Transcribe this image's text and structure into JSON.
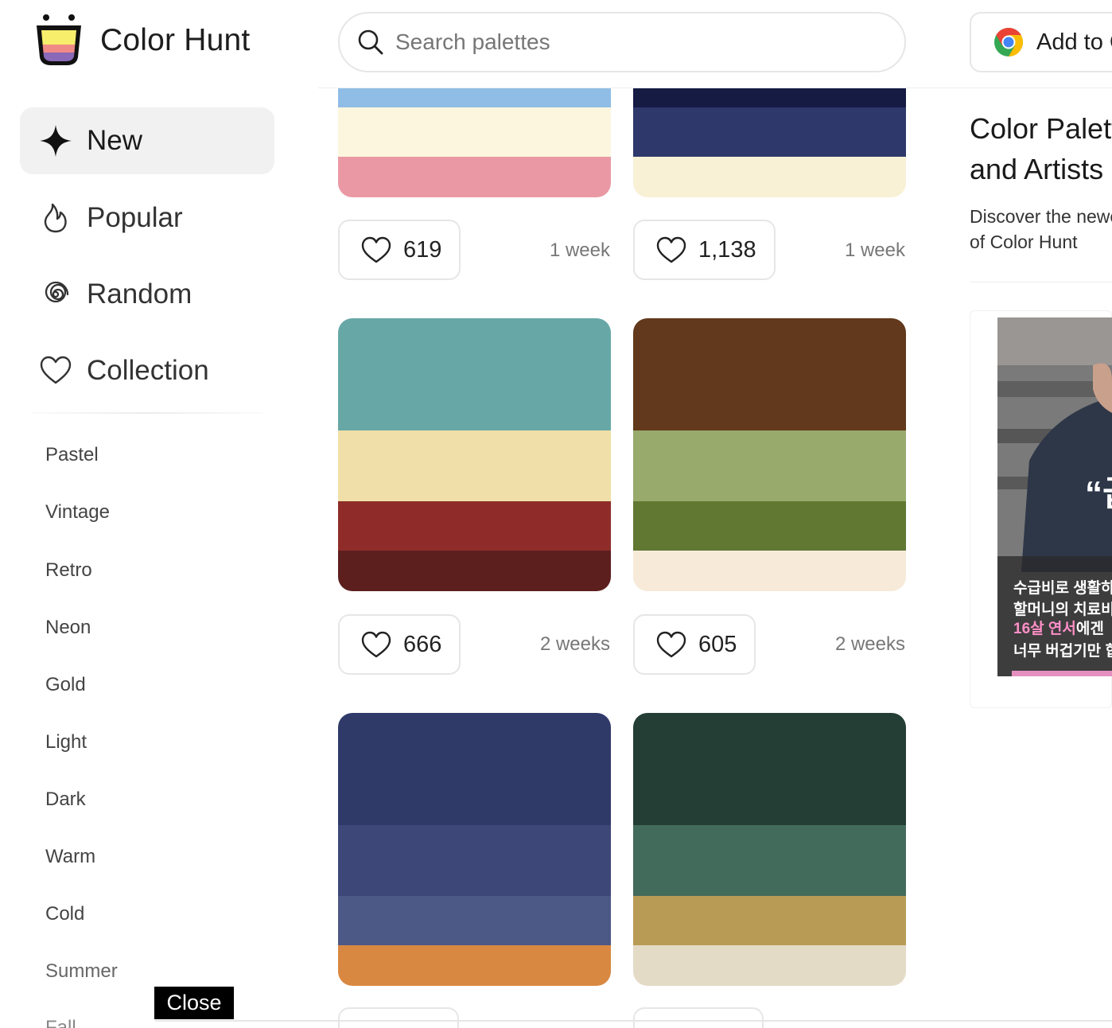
{
  "app": {
    "name": "Color Hunt"
  },
  "search": {
    "placeholder": "Search palettes"
  },
  "extension": {
    "label": "Add to Chrome"
  },
  "nav": {
    "new": "New",
    "popular": "Popular",
    "random": "Random",
    "collection": "Collection"
  },
  "tags": [
    "Pastel",
    "Vintage",
    "Retro",
    "Neon",
    "Gold",
    "Light",
    "Dark",
    "Warm",
    "Cold",
    "Summer",
    "Fall"
  ],
  "palettes": [
    {
      "colors": [
        "#8fbde6",
        "#fcf6df",
        "#ea99a4"
      ],
      "likes": "619",
      "age": "1 week"
    },
    {
      "colors": [
        "#161b44",
        "#2e386b",
        "#f9f1d6"
      ],
      "likes": "1,138",
      "age": "1 week"
    },
    {
      "colors": [
        "#67a8a7",
        "#f0dfa8",
        "#8f2c29",
        "#5c1f1e"
      ],
      "likes": "666",
      "age": "2 weeks"
    },
    {
      "colors": [
        "#62391c",
        "#98aa6c",
        "#617833",
        "#f7ead9"
      ],
      "likes": "605",
      "age": "2 weeks"
    },
    {
      "colors": [
        "#2f3a69",
        "#3d4878",
        "#4c5885",
        "#d98842"
      ]
    },
    {
      "colors": [
        "#243e35",
        "#436b5c",
        "#b89b55",
        "#e4dbc6"
      ]
    }
  ],
  "sidebar_right": {
    "title_line1": "Color Palettes for Designers",
    "title_line2": "and Artists",
    "desc_line1": "Discover the newest hand-picked palettes",
    "desc_line2": "of Color Hunt",
    "ad": {
      "line1": "수급비로 생활하는",
      "line2": "할머니의 치료비",
      "line3a": "16살 연서",
      "line3b": "에겐",
      "line4": "너무 버겁기만 합니다",
      "quote": "“급"
    }
  },
  "close": {
    "label": "Close"
  },
  "colors": {
    "accent": "#000000",
    "border": "#e6e6e6",
    "active_bg": "#f1f1f1"
  }
}
